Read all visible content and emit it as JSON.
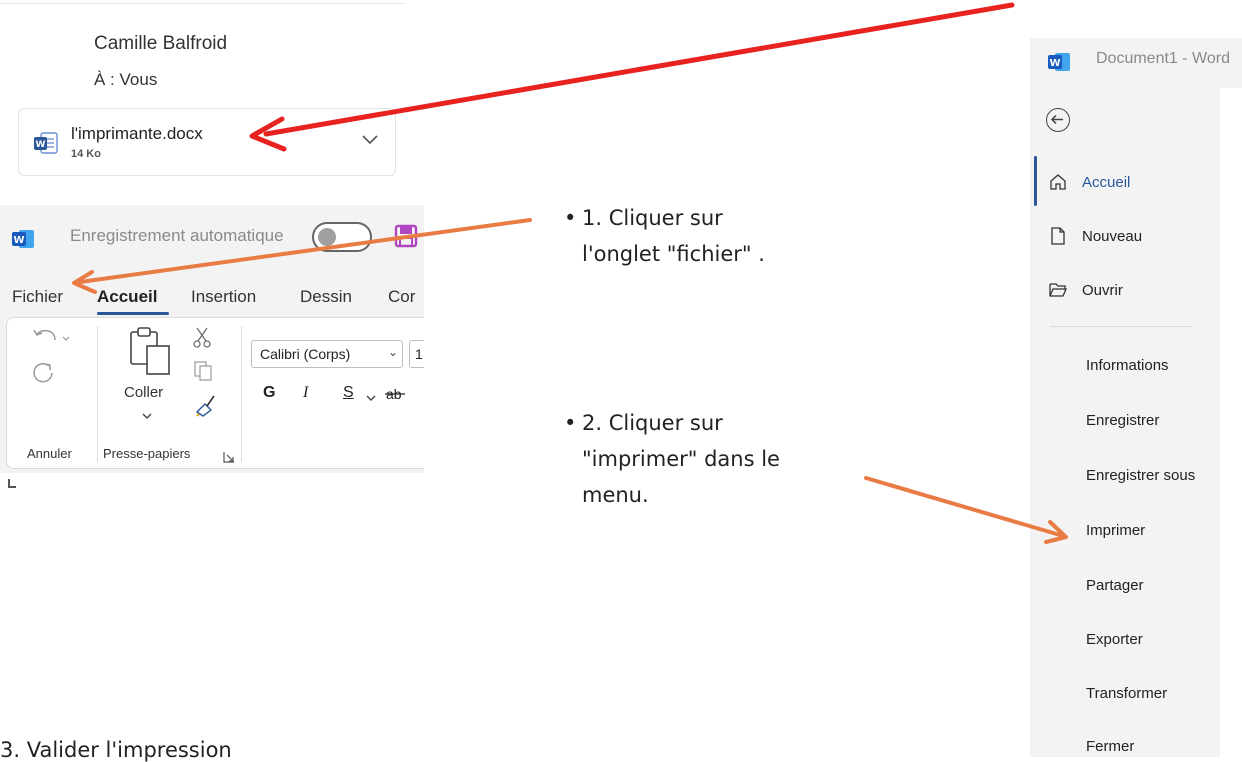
{
  "email": {
    "sender": "Camille Balfroid",
    "recipient": "À : Vous",
    "attachment": {
      "filename": "l'imprimante.docx",
      "size": "14 Ko",
      "icon": "word-file-icon"
    }
  },
  "word_ribbon": {
    "autosave_label": "Enregistrement automatique",
    "tabs": [
      "Fichier",
      "Accueil",
      "Insertion",
      "Dessin",
      "Cor"
    ],
    "active_tab": "Accueil",
    "paste_label": "Coller",
    "font_name": "Calibri (Corps)",
    "font_size": "1",
    "format_buttons": [
      "G",
      "I",
      "S"
    ],
    "groups": [
      "Annuler",
      "Presse-papiers"
    ]
  },
  "instructions": {
    "step1_line1": "1. Cliquer sur",
    "step1_line2": "l'onglet \"fichier\" .",
    "step2_line1": "2. Cliquer sur",
    "step2_line2": "\"imprimer\" dans le",
    "step2_line3": "menu.",
    "step3_partial": "3. Valider l'impression"
  },
  "backstage": {
    "title": "Document1  -  Word",
    "nav": [
      {
        "label": "Accueil",
        "icon": "home-icon",
        "active": true
      },
      {
        "label": "Nouveau",
        "icon": "new-document-icon",
        "active": false
      },
      {
        "label": "Ouvrir",
        "icon": "open-folder-icon",
        "active": false
      }
    ],
    "menu": [
      "Informations",
      "Enregistrer",
      "Enregistrer sous",
      "Imprimer",
      "Partager",
      "Exporter",
      "Transformer",
      "Fermer"
    ]
  },
  "colors": {
    "word_blue": "#2b579a",
    "arrow_red": "#e8231f",
    "arrow_orange": "#e97c45"
  }
}
